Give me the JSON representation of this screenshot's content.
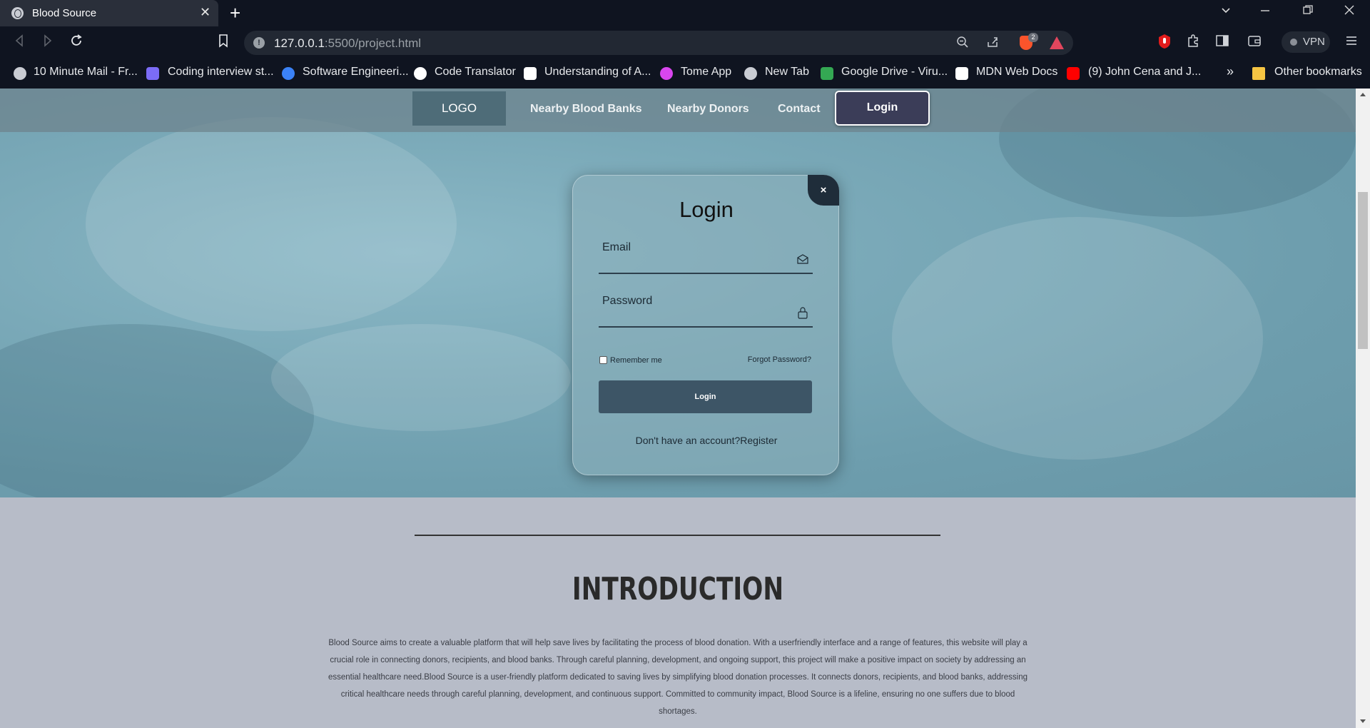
{
  "browser": {
    "tab_title": "Blood Source",
    "tab_close": "✕",
    "new_tab": "+",
    "url_host": "127.0.0.1",
    "url_rest": ":5500/project.html",
    "brave_badge_count": "2",
    "vpn_label": "VPN",
    "bookmarks": [
      {
        "label": "10 Minute Mail - Fr...",
        "icon": "globe-icon",
        "color": "#c9ccd3"
      },
      {
        "label": "Coding interview st...",
        "icon": "code-icon",
        "color": "#7b6cf6"
      },
      {
        "label": "Software Engineeri...",
        "icon": "at-icon",
        "color": "#3b82f6"
      },
      {
        "label": "Code Translator",
        "icon": "triangle-icon",
        "color": "#ffffff"
      },
      {
        "label": "Understanding of A...",
        "icon": "medium-icon",
        "color": "#ffffff"
      },
      {
        "label": "Tome App",
        "icon": "tome-icon",
        "color": "#d946ef"
      },
      {
        "label": "New Tab",
        "icon": "globe-icon",
        "color": "#c9ccd3"
      },
      {
        "label": "Google Drive - Viru...",
        "icon": "drive-icon",
        "color": "#34a853"
      },
      {
        "label": "MDN Web Docs",
        "icon": "mdn-icon",
        "color": "#ffffff"
      },
      {
        "label": "(9) John Cena and J...",
        "icon": "youtube-icon",
        "color": "#ff0000"
      }
    ],
    "bookmarks_more": "»",
    "other_bookmarks": "Other bookmarks"
  },
  "site": {
    "nav": {
      "logo": "LOGO",
      "links": [
        "Nearby Blood Banks",
        "Nearby Donors",
        "Contact"
      ],
      "login": "Login"
    },
    "login_modal": {
      "close": "×",
      "title": "Login",
      "email_label": "Email",
      "password_label": "Password",
      "remember_label": "Remember me",
      "forgot_label": "Forgot Password?",
      "submit_label": "Login",
      "no_account_text": "Don't have an account?",
      "register_link": "Register"
    },
    "intro": {
      "title": "INTRODUCTION",
      "text": "Blood Source aims to create a valuable platform that will help save lives by facilitating the process of blood donation. With a userfriendly interface and a range of features, this website will play a crucial role in connecting donors, recipients, and blood banks. Through careful planning, development, and ongoing support, this project will make a positive impact on society by addressing an essential healthcare need.Blood Source is a user-friendly platform dedicated to saving lives by simplifying blood donation processes. It connects donors, recipients, and blood banks, addressing critical healthcare needs through careful planning, development, and continuous support. Committed to community impact, Blood Source is a lifeline, ensuring no one suffers due to blood shortages."
    }
  }
}
